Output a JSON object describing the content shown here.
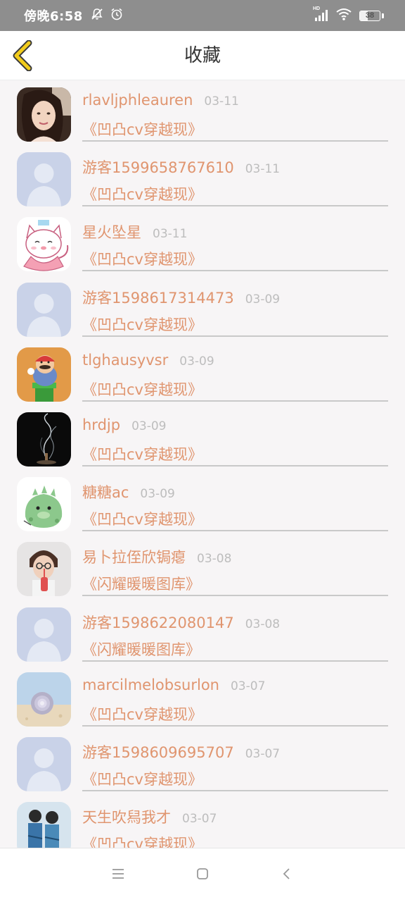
{
  "status_bar": {
    "time": "傍晚6:58",
    "icons": [
      "mute-icon",
      "alarm-icon",
      "signal-icon",
      "wifi-icon"
    ],
    "signal_label": "HD",
    "battery_level": "38",
    "battery_fraction": 0.38
  },
  "header": {
    "title": "收藏",
    "back_icon": "chevron-left-icon",
    "accent_color": "#f2cc1c"
  },
  "colors": {
    "name_text": "#e0956f",
    "date_text": "#bdbdbd",
    "background": "#f7f5f6"
  },
  "favorites": [
    {
      "name": "rlavljphleauren",
      "date": "03-11",
      "work": "《凹凸cv穿越现》",
      "avatar": "girl-photo"
    },
    {
      "name": "游客1599658767610",
      "date": "03-11",
      "work": "《凹凸cv穿越现》",
      "avatar": "default-user"
    },
    {
      "name": "星火坠星",
      "date": "03-11",
      "work": "《凹凸cv穿越现》",
      "avatar": "cat-drawing"
    },
    {
      "name": "游客1598617314473",
      "date": "03-09",
      "work": "《凹凸cv穿越现》",
      "avatar": "default-user"
    },
    {
      "name": "tlghausyvsr",
      "date": "03-09",
      "work": "《凹凸cv穿越现》",
      "avatar": "cartoon-character"
    },
    {
      "name": "hrdjp",
      "date": "03-09",
      "work": "《凹凸cv穿越现》",
      "avatar": "incense-smoke"
    },
    {
      "name": "糖糖ac",
      "date": "03-09",
      "work": "《凹凸cv穿越现》",
      "avatar": "green-monster"
    },
    {
      "name": "易卜拉侄欣锔瘪",
      "date": "03-08",
      "work": "《闪耀暖暖图库》",
      "avatar": "child-photo"
    },
    {
      "name": "游客1598622080147",
      "date": "03-08",
      "work": "《闪耀暖暖图库》",
      "avatar": "default-user"
    },
    {
      "name": "marcilmelobsurlon",
      "date": "03-07",
      "work": "《凹凸cv穿越现》",
      "avatar": "seashell"
    },
    {
      "name": "游客1598609695707",
      "date": "03-07",
      "work": "《凹凸cv穿越现》",
      "avatar": "default-user"
    },
    {
      "name": "天生吹舄我才",
      "date": "03-07",
      "work": "《凹凸cv穿越现》",
      "avatar": "couple-photo"
    }
  ],
  "nav_bar": {
    "buttons": [
      "menu-icon",
      "home-icon",
      "back-icon"
    ]
  }
}
